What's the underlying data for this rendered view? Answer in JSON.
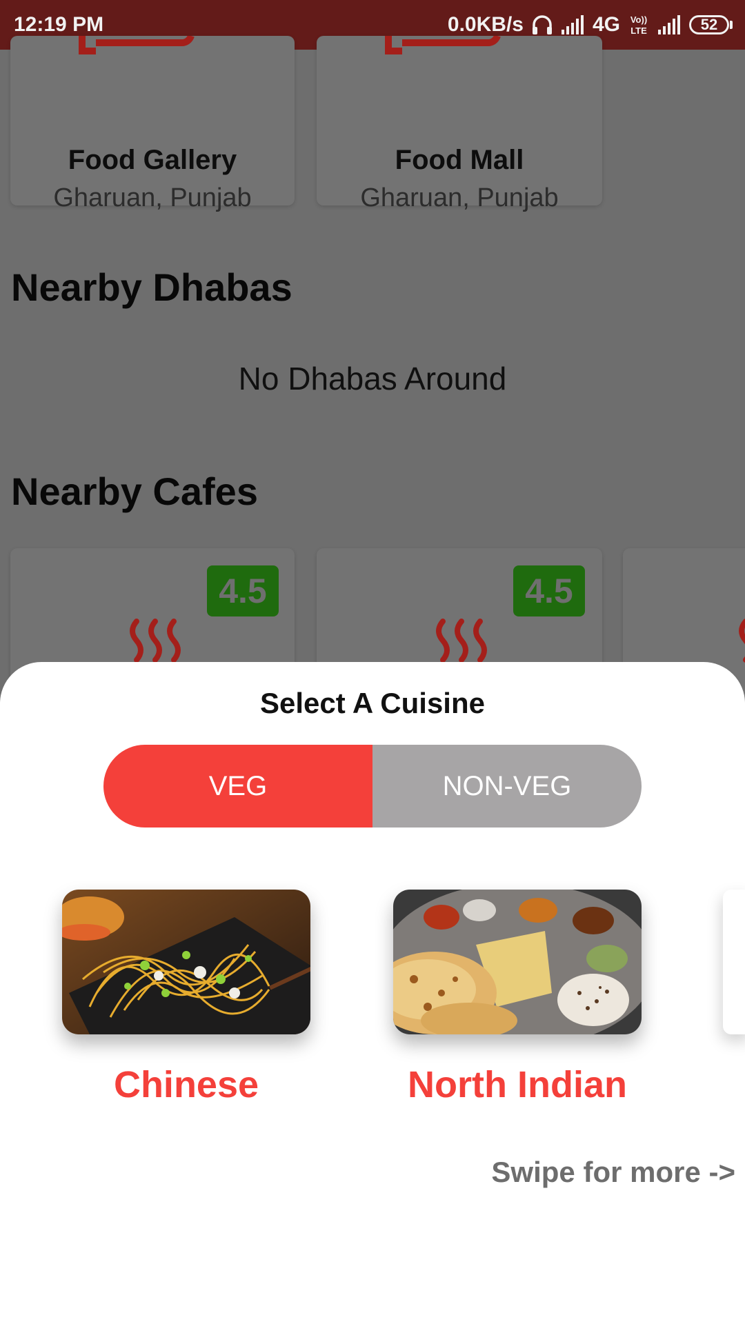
{
  "status_bar": {
    "time": "12:19 PM",
    "net_speed": "0.0KB/s",
    "network_type": "4G",
    "volte_label": "Vo)) LTE",
    "battery_level": "52"
  },
  "background": {
    "restaurants": [
      {
        "name": "Food Gallery",
        "location": "Gharuan, Punjab"
      },
      {
        "name": "Food Mall",
        "location": "Gharuan, Punjab"
      }
    ],
    "dhabas_section": {
      "title": "Nearby Dhabas",
      "empty_text": "No Dhabas Around"
    },
    "cafes_section": {
      "title": "Nearby Cafes",
      "cafes": [
        {
          "rating": "4.5"
        },
        {
          "rating": "4.5"
        }
      ]
    }
  },
  "sheet": {
    "title": "Select A Cuisine",
    "toggle": {
      "veg_label": "VEG",
      "nonveg_label": "NON-VEG",
      "selected": "VEG"
    },
    "cuisines": [
      {
        "label": "Chinese",
        "image": "noodles-image"
      },
      {
        "label": "North Indian",
        "image": "thali-image"
      }
    ],
    "swipe_hint": "Swipe for more ->"
  },
  "colors": {
    "accent": "#f4403a",
    "status_bar": "#631b19",
    "toggle_inactive": "#a7a5a6",
    "rating_badge": "#1f6b0e"
  }
}
